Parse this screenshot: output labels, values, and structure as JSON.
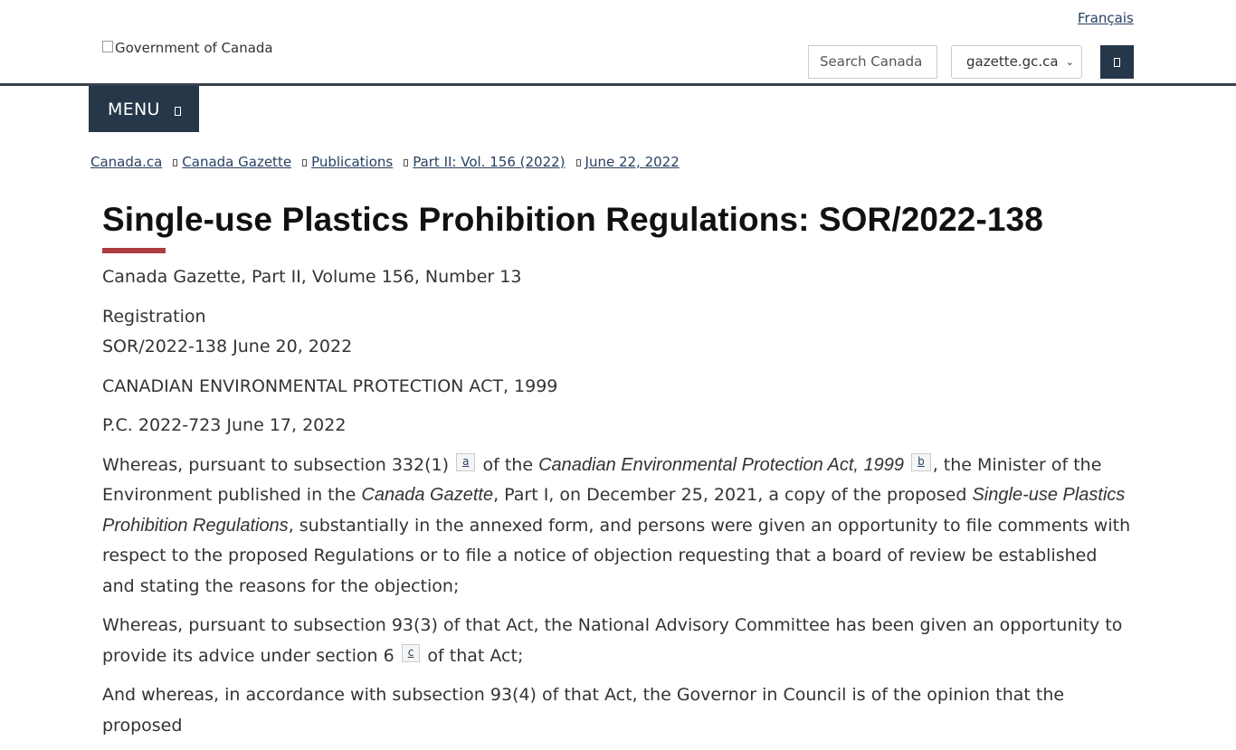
{
  "header": {
    "language_link": "Français",
    "logo_alt": "Government of Canada",
    "search": {
      "placeholder": "Search Canada"
    },
    "scope_select": {
      "selected": "gazette.gc.ca"
    },
    "menu_label": "MENU"
  },
  "breadcrumb": [
    "Canada.ca",
    "Canada Gazette",
    "Publications",
    "Part II: Vol. 156 (2022)",
    "June 22, 2022"
  ],
  "page": {
    "title": "Single-use Plastics Prohibition Regulations: SOR/2022-138",
    "publication": "Canada Gazette, Part II, Volume 156, Number 13",
    "registration_label": "Registration",
    "registration": "SOR/2022-138 June 20, 2022",
    "act": "CANADIAN ENVIRONMENTAL PROTECTION ACT, 1999",
    "order": "P.C. 2022-723 June 17, 2022",
    "para1": {
      "t1": "Whereas, pursuant to subsection 332(1)",
      "fn_a": "a",
      "t2": "of the",
      "i1": "Canadian Environmental Protection Act, 1999",
      "fn_b": "b",
      "t3": ", the Minister of the Environment published in the",
      "i2": "Canada Gazette",
      "t4": ", Part I, on December 25, 2021, a copy of the proposed",
      "i3": "Single-use Plastics Prohibition Regulations",
      "t5": ", substantially in the annexed form, and persons were given an opportunity to file comments with respect to the proposed Regulations or to file a notice of objection requesting that a board of review be established and stating the reasons for the objection;"
    },
    "para2": {
      "t1": "Whereas, pursuant to subsection 93(3) of that Act, the National Advisory Committee has been given an opportunity to provide its advice under section 6",
      "fn_c": "c",
      "t2": "of that Act;"
    },
    "para3": "And whereas, in accordance with subsection 93(4) of that Act, the Governor in Council is of the opinion that the proposed"
  },
  "colors": {
    "brand_dark": "#26374a",
    "link": "#284162",
    "title_accent": "#af3c43"
  },
  "icons": {
    "search_button": "search-icon",
    "menu": "chevron-down-icon",
    "breadcrumb_separator": "chevron-right-icon"
  }
}
